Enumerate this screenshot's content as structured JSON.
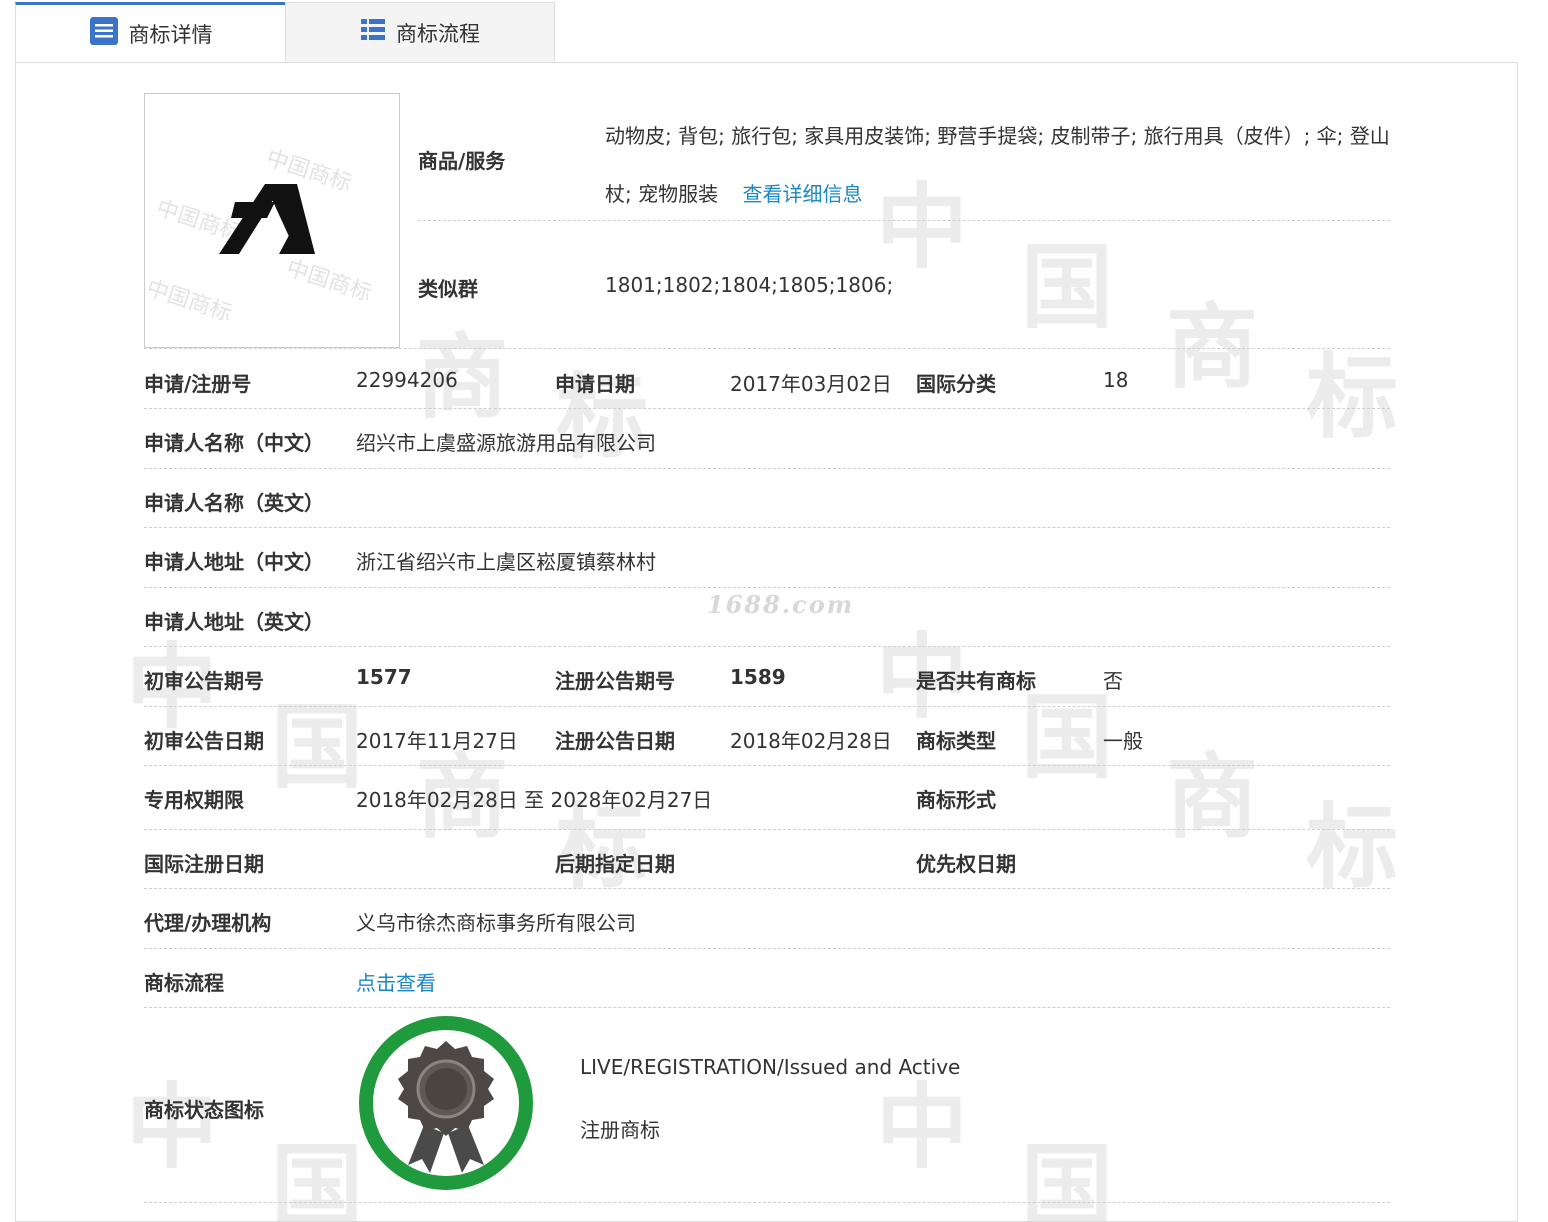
{
  "tabs": {
    "detail": "商标详情",
    "flow": "商标流程"
  },
  "watermark": {
    "chars": [
      "中",
      "国",
      "商",
      "标"
    ],
    "site": "1688.com"
  },
  "goods": {
    "label": "商品/服务",
    "text": "动物皮; 背包; 旅行包; 家具用皮装饰; 野营手提袋; 皮制带子; 旅行用具（皮件）; 伞; 登山杖; 宠物服装",
    "more_link": "查看详细信息"
  },
  "similar": {
    "label": "类似群",
    "value": "1801;1802;1804;1805;1806;"
  },
  "rows": {
    "reg_no": {
      "label": "申请/注册号",
      "value": "22994206"
    },
    "app_date": {
      "label": "申请日期",
      "value": "2017年03月02日"
    },
    "intl_class": {
      "label": "国际分类",
      "value": "18"
    },
    "applicant_cn": {
      "label": "申请人名称（中文）",
      "value": "绍兴市上虞盛源旅游用品有限公司"
    },
    "applicant_en": {
      "label": "申请人名称（英文）",
      "value": ""
    },
    "address_cn": {
      "label": "申请人地址（中文）",
      "value": "浙江省绍兴市上虞区崧厦镇蔡林村"
    },
    "address_en": {
      "label": "申请人地址（英文）",
      "value": ""
    },
    "prelim_issue": {
      "label": "初审公告期号",
      "value": "1577"
    },
    "reg_issue": {
      "label": "注册公告期号",
      "value": "1589"
    },
    "shared": {
      "label": "是否共有商标",
      "value": "否"
    },
    "prelim_date": {
      "label": "初审公告日期",
      "value": "2017年11月27日"
    },
    "reg_date": {
      "label": "注册公告日期",
      "value": "2018年02月28日"
    },
    "tm_type": {
      "label": "商标类型",
      "value": "一般"
    },
    "exclusive": {
      "label": "专用权期限",
      "value": "2018年02月28日 至 2028年02月27日"
    },
    "tm_form": {
      "label": "商标形式",
      "value": ""
    },
    "intl_reg_date": {
      "label": "国际注册日期",
      "value": ""
    },
    "later_date": {
      "label": "后期指定日期",
      "value": ""
    },
    "priority_date": {
      "label": "优先权日期",
      "value": ""
    },
    "agent": {
      "label": "代理/办理机构",
      "value": "义乌市徐杰商标事务所有限公司"
    },
    "flow": {
      "label": "商标流程",
      "link": "点击查看"
    },
    "status": {
      "label": "商标状态图标",
      "en": "LIVE/REGISTRATION/Issued and Active",
      "cn": "注册商标"
    }
  },
  "colors": {
    "accent": "#3b73c8",
    "link": "#1a87c6",
    "status_ring": "#1f9a3c"
  },
  "icons": {
    "detail_tab": "document-list-icon",
    "flow_tab": "list-icon",
    "status": "award-ribbon-icon"
  }
}
